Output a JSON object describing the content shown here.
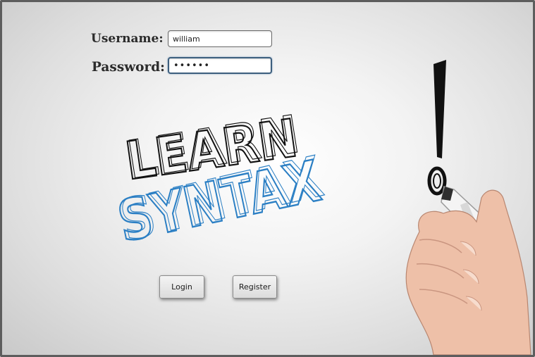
{
  "login_form": {
    "username_label": "Username:",
    "username_value": "william",
    "password_label": "Password:",
    "password_value": "••••••"
  },
  "actions": {
    "login_label": "Login",
    "register_label": "Register"
  },
  "artwork": {
    "line1": "LEARN",
    "line2": "SYNTAX",
    "line1_color": "#111111",
    "line2_color": "#2b7fc4"
  }
}
